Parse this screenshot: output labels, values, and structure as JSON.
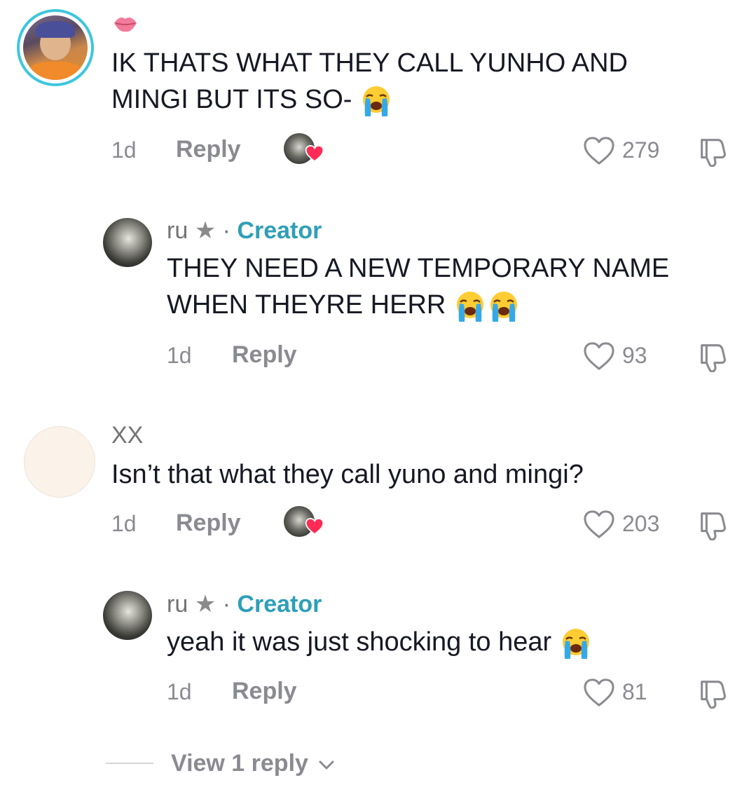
{
  "comments": [
    {
      "username_icon": "kiss-lips-icon",
      "text_line1": "IK THATS WHAT THEY CALL YUNHO AND",
      "text_line2": "MINGI BUT ITS SO-",
      "emoji": "crying-face",
      "time": "1d",
      "reply_label": "Reply",
      "liked_by_creator": true,
      "likes": "279"
    },
    {
      "username": "ru",
      "username_star": "★",
      "separator": "·",
      "badge": "Creator",
      "text_line1": "THEY NEED A NEW TEMPORARY NAME",
      "text_line2": "WHEN THEYRE HERR",
      "emoji": "crying-face",
      "time": "1d",
      "reply_label": "Reply",
      "likes": "93"
    },
    {
      "username": "XX",
      "text_line1": "Isn’t that what they call yuno and mingi?",
      "time": "1d",
      "reply_label": "Reply",
      "liked_by_creator": true,
      "likes": "203"
    },
    {
      "username": "ru",
      "username_star": "★",
      "separator": "·",
      "badge": "Creator",
      "text_line1": "yeah it was just shocking to hear",
      "emoji": "crying-face",
      "time": "1d",
      "reply_label": "Reply",
      "likes": "81"
    }
  ],
  "view_replies_label": "View 1 reply",
  "colors": {
    "creator": "#2e9fb8",
    "avatar_ring": "#3fc6dd",
    "heart_red": "#fe2c55",
    "muted": "#8a8b91"
  }
}
